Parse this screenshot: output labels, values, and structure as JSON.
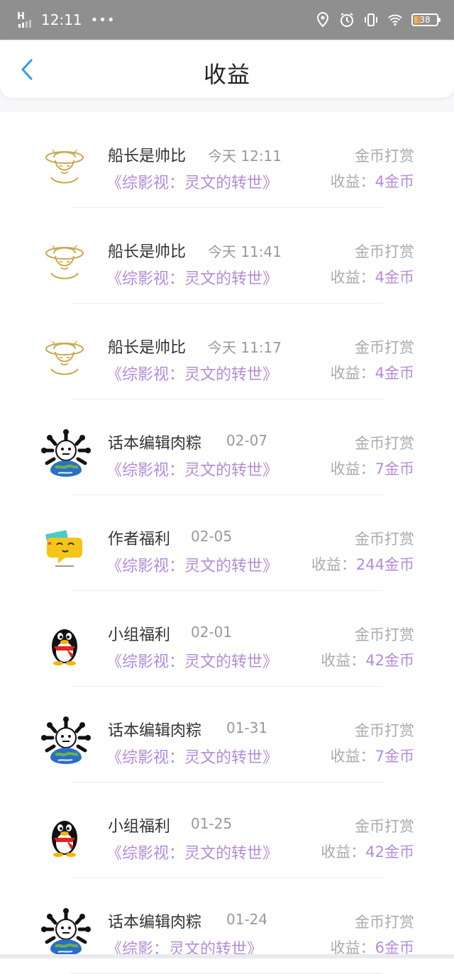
{
  "status_bar": {
    "network": "H",
    "time": "12:11",
    "dots": "•••",
    "battery": "38"
  },
  "header": {
    "title": "收益"
  },
  "items": [
    {
      "name": "船长是帅比",
      "date": "今天 12:11",
      "type": "金币打赏",
      "work": "《综影视：灵文的转世》",
      "earn_label": "收益：",
      "earn_value": "4金币",
      "avatar": "straw-hat-avatar"
    },
    {
      "name": "船长是帅比",
      "date": "今天 11:41",
      "type": "金币打赏",
      "work": "《综影视：灵文的转世》",
      "earn_label": "收益：",
      "earn_value": "4金币",
      "avatar": "straw-hat-avatar"
    },
    {
      "name": "船长是帅比",
      "date": "今天 11:17",
      "type": "金币打赏",
      "work": "《综影视：灵文的转世》",
      "earn_label": "收益：",
      "earn_value": "4金币",
      "avatar": "straw-hat-avatar"
    },
    {
      "name": "话本编辑肉粽",
      "date": "02-07",
      "type": "金币打赏",
      "work": "《综影视：灵文的转世》",
      "earn_label": "收益：",
      "earn_value": "7金币",
      "avatar": "earth-skull-avatar"
    },
    {
      "name": "作者福利",
      "date": "02-05",
      "type": "金币打赏",
      "work": "《综影视：灵文的转世》",
      "earn_label": "收益：",
      "earn_value": "244金币",
      "avatar": "chat-bubble-avatar"
    },
    {
      "name": "小组福利",
      "date": "02-01",
      "type": "金币打赏",
      "work": "《综影视：灵文的转世》",
      "earn_label": "收益：",
      "earn_value": "42金币",
      "avatar": "penguin-avatar"
    },
    {
      "name": "话本编辑肉粽",
      "date": "01-31",
      "type": "金币打赏",
      "work": "《综影视：灵文的转世》",
      "earn_label": "收益：",
      "earn_value": "7金币",
      "avatar": "earth-skull-avatar"
    },
    {
      "name": "小组福利",
      "date": "01-25",
      "type": "金币打赏",
      "work": "《综影视：灵文的转世》",
      "earn_label": "收益：",
      "earn_value": "42金币",
      "avatar": "penguin-avatar"
    },
    {
      "name": "话本编辑肉粽",
      "date": "01-24",
      "type": "金币打赏",
      "work": "《综影：灵文的转世》",
      "earn_label": "收益：",
      "earn_value": "6金币",
      "avatar": "earth-skull-avatar"
    }
  ],
  "colors": {
    "status_bar": "#8f8f8f",
    "accent_purple": "#b58bd8",
    "back_arrow": "#2e9bf0"
  }
}
